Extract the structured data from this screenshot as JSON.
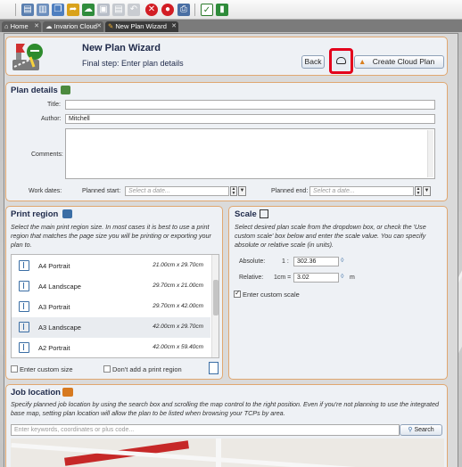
{
  "toolbar": {
    "icons": [
      "new-page-icon",
      "open-icon",
      "copy-icon",
      "export-icon",
      "cloud-icon",
      "save-icon",
      "print-icon",
      "undo-icon",
      "close-red-icon",
      "stop-red-icon",
      "printer-icon",
      "checkbox-icon",
      "chart-icon"
    ]
  },
  "tabs": [
    {
      "label": "Home"
    },
    {
      "label": "Invarion Cloud"
    },
    {
      "label": "New Plan Wizard"
    }
  ],
  "wizard": {
    "title": "New Plan Wizard",
    "subtitle": "Final step: Enter plan details",
    "back_label": "Back",
    "create_label": "Create Cloud Plan"
  },
  "plan_details": {
    "heading": "Plan details",
    "title_label": "Title:",
    "title_value": "",
    "author_label": "Author:",
    "author_value": "Mitchell",
    "comments_label": "Comments:",
    "comments_value": "",
    "work_dates_label": "Work dates:",
    "planned_start_label": "Planned start:",
    "planned_start_placeholder": "Select a date...",
    "planned_end_label": "Planned end:",
    "planned_end_placeholder": "Select a date..."
  },
  "print_region": {
    "heading": "Print region",
    "description": "Select the main print region size. In most cases it is best to use a print region that matches the page size you will be printing or exporting your plan to.",
    "items": [
      {
        "name": "A4 Portrait",
        "size": "21.00cm x 29.70cm"
      },
      {
        "name": "A4 Landscape",
        "size": "29.70cm x 21.00cm"
      },
      {
        "name": "A3 Portrait",
        "size": "29.70cm x 42.00cm"
      },
      {
        "name": "A3 Landscape",
        "size": "42.00cm x 29.70cm"
      },
      {
        "name": "A2 Portrait",
        "size": "42.00cm x 59.40cm"
      }
    ],
    "custom_size_label": "Enter custom size",
    "no_print_region_label": "Don't add a print region"
  },
  "scale": {
    "heading": "Scale",
    "description": "Select desired plan scale from the dropdown box, or check the 'Use custom scale' box below and enter the scale value. You can specify absolute or relative scale (in units).",
    "absolute_label": "Absolute:",
    "absolute_prefix": "1 :",
    "absolute_value": "302.36",
    "relative_label": "Relative:",
    "relative_prefix": "1cm =",
    "relative_value": "3.02",
    "relative_unit": "m",
    "custom_scale_label": "Enter custom scale"
  },
  "job_location": {
    "heading": "Job location",
    "description": "Specify planned job location by using the search box and scrolling the map control to the right position. Even if you're not planning to use the integrated base map, setting plan location will allow the plan to be listed when browsing your TCPs by area.",
    "search_placeholder": "Enter keywords, coordinates or plus code...",
    "search_button": "Search"
  },
  "colors": {
    "panel_border": "#e0a770",
    "highlight_red": "#e3001b",
    "heading_navy": "#1f2a4a"
  }
}
